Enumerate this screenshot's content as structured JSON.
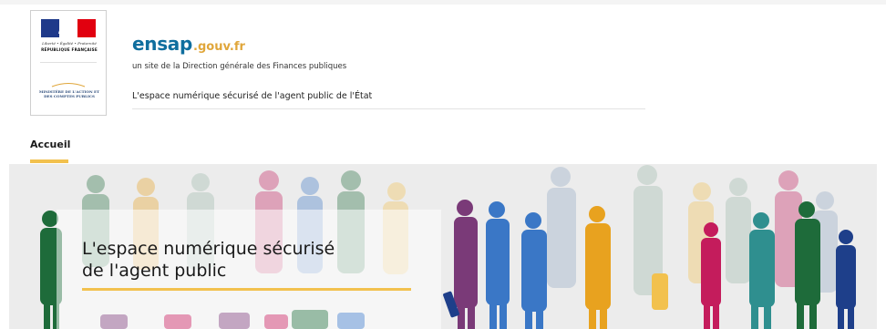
{
  "header": {
    "logo": {
      "flag_colors": [
        "#1f3a8a",
        "#ffffff",
        "#e1000f"
      ],
      "motto": "Liberté • Égalité • Fraternité",
      "republic": "RÉPUBLIQUE FRANÇAISE",
      "ministry": "MINISTÈRE DE L'ACTION ET DES COMPTES PUBLICS"
    },
    "brand_main": "ensap",
    "brand_suffix": ".gouv.fr",
    "tagline": "un site de la Direction générale des Finances publiques",
    "subtitle": "L'espace numérique sécurisé de l'agent public de l'État"
  },
  "nav": {
    "items": [
      {
        "label": "Accueil",
        "active": true
      }
    ]
  },
  "banner": {
    "title_line1": "L'espace numérique sécurisé",
    "title_line2": "de l'agent public",
    "accent_color": "#f2c14e",
    "silhouette_colors": [
      "#1e6b3a",
      "#7a3a78",
      "#c41c5c",
      "#3a77c6",
      "#e8a21f",
      "#8fa7c2",
      "#9ab8a8",
      "#f2c14e",
      "#2f8f8f",
      "#1e3f8a"
    ]
  }
}
